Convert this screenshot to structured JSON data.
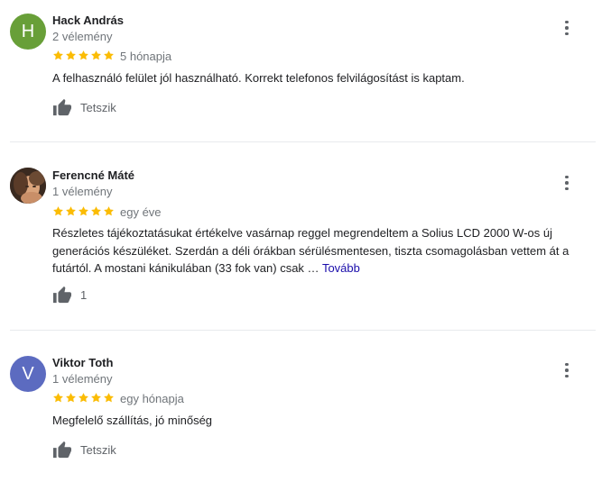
{
  "colors": {
    "star": "#fbbc04",
    "avatar_h": "#689f38",
    "avatar_v": "#5c6bc0",
    "link": "#1a0dab"
  },
  "reviews": [
    {
      "initial": "H",
      "author": "Hack András",
      "review_count": "2 vélemény",
      "rating": 5,
      "time": "5 hónapja",
      "text": "A felhasználó felület jól használható. Korrekt telefonos felvilágosítást is kaptam.",
      "like_label": "Tetszik",
      "avatar_icon": "letter-avatar"
    },
    {
      "initial": "",
      "author": "Ferencné Máté",
      "review_count": "1 vélemény",
      "rating": 5,
      "time": "egy éve",
      "text": "Részletes tájékoztatásukat értékelve vasárnap reggel megrendeltem a Solius LCD 2000 W-os új generációs készüléket. Szerdán a déli órákban sérülésmentesen, tiszta csomagolásban vettem át a futártól. A mostani kánikulában (33 fok van) csak …",
      "more_label": "Tovább",
      "like_label": "1",
      "avatar_icon": "photo-avatar"
    },
    {
      "initial": "V",
      "author": "Viktor Toth",
      "review_count": "1 vélemény",
      "rating": 5,
      "time": "egy hónapja",
      "text": "Megfelelő szállítás, jó minőség",
      "like_label": "Tetszik",
      "avatar_icon": "letter-avatar"
    }
  ]
}
